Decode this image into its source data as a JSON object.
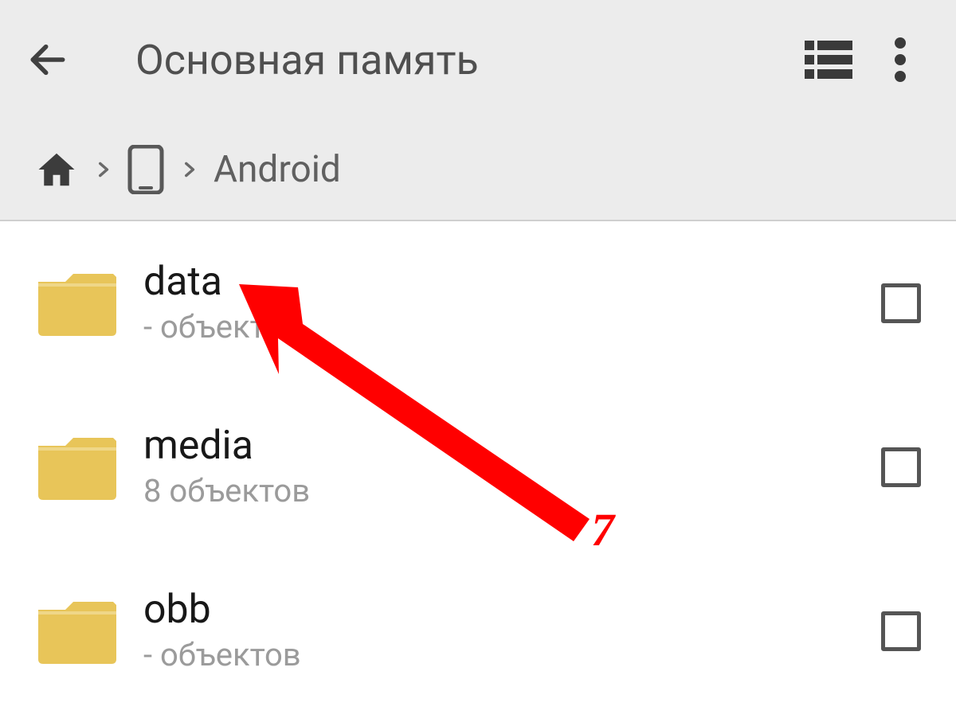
{
  "toolbar": {
    "title": "Основная память"
  },
  "breadcrumb": {
    "current": "Android"
  },
  "folders": [
    {
      "name": "data",
      "sub": "- объектов"
    },
    {
      "name": "media",
      "sub": "8 объектов"
    },
    {
      "name": "obb",
      "sub": "- объектов"
    }
  ],
  "annotation": {
    "label": "7"
  },
  "colors": {
    "folder": "#e8c559",
    "header_bg": "#ececec",
    "arrow": "#ff0000"
  }
}
